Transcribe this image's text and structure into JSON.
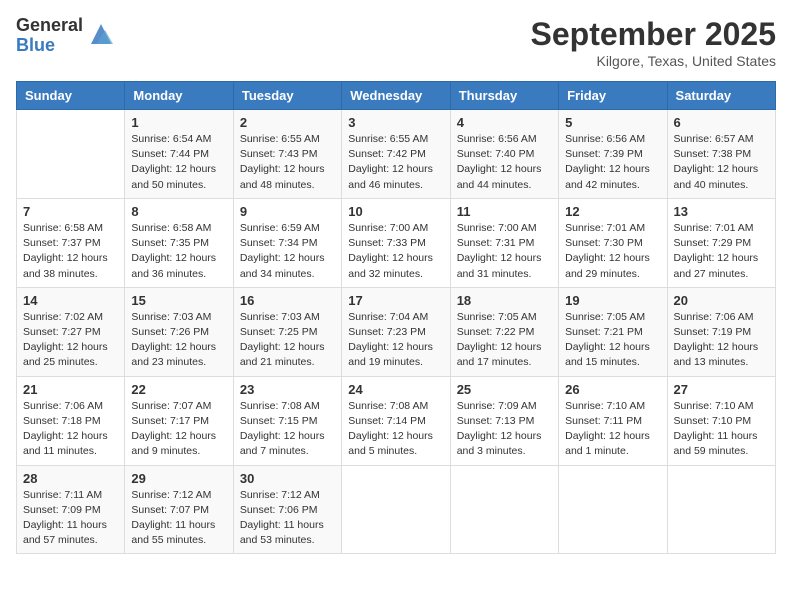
{
  "header": {
    "logo_general": "General",
    "logo_blue": "Blue",
    "month_title": "September 2025",
    "location": "Kilgore, Texas, United States"
  },
  "weekdays": [
    "Sunday",
    "Monday",
    "Tuesday",
    "Wednesday",
    "Thursday",
    "Friday",
    "Saturday"
  ],
  "weeks": [
    [
      {
        "day": "",
        "info": ""
      },
      {
        "day": "1",
        "info": "Sunrise: 6:54 AM\nSunset: 7:44 PM\nDaylight: 12 hours\nand 50 minutes."
      },
      {
        "day": "2",
        "info": "Sunrise: 6:55 AM\nSunset: 7:43 PM\nDaylight: 12 hours\nand 48 minutes."
      },
      {
        "day": "3",
        "info": "Sunrise: 6:55 AM\nSunset: 7:42 PM\nDaylight: 12 hours\nand 46 minutes."
      },
      {
        "day": "4",
        "info": "Sunrise: 6:56 AM\nSunset: 7:40 PM\nDaylight: 12 hours\nand 44 minutes."
      },
      {
        "day": "5",
        "info": "Sunrise: 6:56 AM\nSunset: 7:39 PM\nDaylight: 12 hours\nand 42 minutes."
      },
      {
        "day": "6",
        "info": "Sunrise: 6:57 AM\nSunset: 7:38 PM\nDaylight: 12 hours\nand 40 minutes."
      }
    ],
    [
      {
        "day": "7",
        "info": "Sunrise: 6:58 AM\nSunset: 7:37 PM\nDaylight: 12 hours\nand 38 minutes."
      },
      {
        "day": "8",
        "info": "Sunrise: 6:58 AM\nSunset: 7:35 PM\nDaylight: 12 hours\nand 36 minutes."
      },
      {
        "day": "9",
        "info": "Sunrise: 6:59 AM\nSunset: 7:34 PM\nDaylight: 12 hours\nand 34 minutes."
      },
      {
        "day": "10",
        "info": "Sunrise: 7:00 AM\nSunset: 7:33 PM\nDaylight: 12 hours\nand 32 minutes."
      },
      {
        "day": "11",
        "info": "Sunrise: 7:00 AM\nSunset: 7:31 PM\nDaylight: 12 hours\nand 31 minutes."
      },
      {
        "day": "12",
        "info": "Sunrise: 7:01 AM\nSunset: 7:30 PM\nDaylight: 12 hours\nand 29 minutes."
      },
      {
        "day": "13",
        "info": "Sunrise: 7:01 AM\nSunset: 7:29 PM\nDaylight: 12 hours\nand 27 minutes."
      }
    ],
    [
      {
        "day": "14",
        "info": "Sunrise: 7:02 AM\nSunset: 7:27 PM\nDaylight: 12 hours\nand 25 minutes."
      },
      {
        "day": "15",
        "info": "Sunrise: 7:03 AM\nSunset: 7:26 PM\nDaylight: 12 hours\nand 23 minutes."
      },
      {
        "day": "16",
        "info": "Sunrise: 7:03 AM\nSunset: 7:25 PM\nDaylight: 12 hours\nand 21 minutes."
      },
      {
        "day": "17",
        "info": "Sunrise: 7:04 AM\nSunset: 7:23 PM\nDaylight: 12 hours\nand 19 minutes."
      },
      {
        "day": "18",
        "info": "Sunrise: 7:05 AM\nSunset: 7:22 PM\nDaylight: 12 hours\nand 17 minutes."
      },
      {
        "day": "19",
        "info": "Sunrise: 7:05 AM\nSunset: 7:21 PM\nDaylight: 12 hours\nand 15 minutes."
      },
      {
        "day": "20",
        "info": "Sunrise: 7:06 AM\nSunset: 7:19 PM\nDaylight: 12 hours\nand 13 minutes."
      }
    ],
    [
      {
        "day": "21",
        "info": "Sunrise: 7:06 AM\nSunset: 7:18 PM\nDaylight: 12 hours\nand 11 minutes."
      },
      {
        "day": "22",
        "info": "Sunrise: 7:07 AM\nSunset: 7:17 PM\nDaylight: 12 hours\nand 9 minutes."
      },
      {
        "day": "23",
        "info": "Sunrise: 7:08 AM\nSunset: 7:15 PM\nDaylight: 12 hours\nand 7 minutes."
      },
      {
        "day": "24",
        "info": "Sunrise: 7:08 AM\nSunset: 7:14 PM\nDaylight: 12 hours\nand 5 minutes."
      },
      {
        "day": "25",
        "info": "Sunrise: 7:09 AM\nSunset: 7:13 PM\nDaylight: 12 hours\nand 3 minutes."
      },
      {
        "day": "26",
        "info": "Sunrise: 7:10 AM\nSunset: 7:11 PM\nDaylight: 12 hours\nand 1 minute."
      },
      {
        "day": "27",
        "info": "Sunrise: 7:10 AM\nSunset: 7:10 PM\nDaylight: 11 hours\nand 59 minutes."
      }
    ],
    [
      {
        "day": "28",
        "info": "Sunrise: 7:11 AM\nSunset: 7:09 PM\nDaylight: 11 hours\nand 57 minutes."
      },
      {
        "day": "29",
        "info": "Sunrise: 7:12 AM\nSunset: 7:07 PM\nDaylight: 11 hours\nand 55 minutes."
      },
      {
        "day": "30",
        "info": "Sunrise: 7:12 AM\nSunset: 7:06 PM\nDaylight: 11 hours\nand 53 minutes."
      },
      {
        "day": "",
        "info": ""
      },
      {
        "day": "",
        "info": ""
      },
      {
        "day": "",
        "info": ""
      },
      {
        "day": "",
        "info": ""
      }
    ]
  ]
}
